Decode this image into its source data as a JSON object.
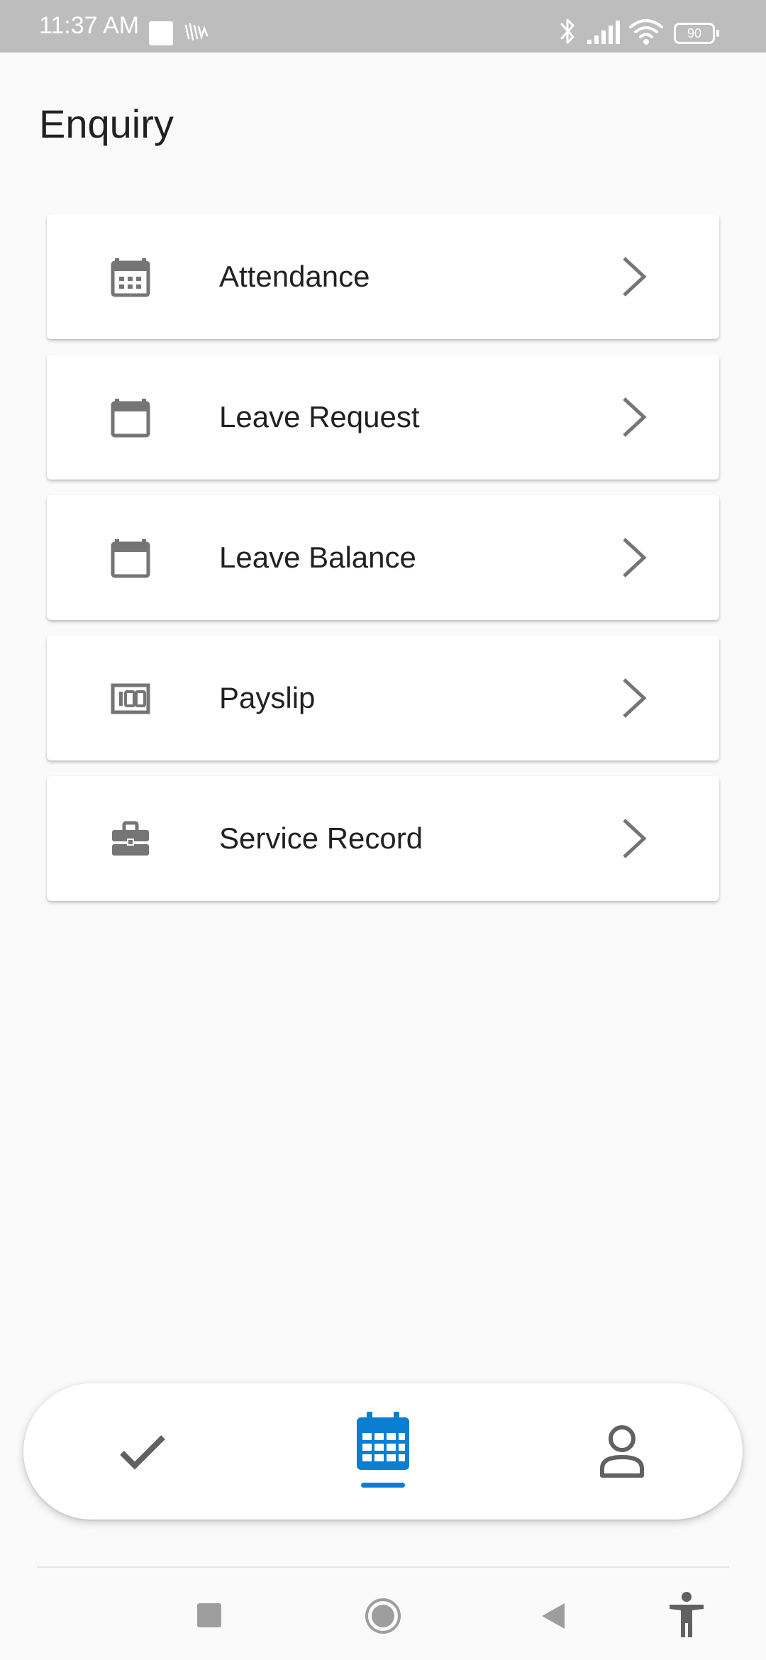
{
  "status_bar": {
    "time": "11:37 AM",
    "battery": "90",
    "icons": [
      "notification-square-icon",
      "vibrate-icon",
      "bluetooth-icon",
      "signal-icon",
      "wifi-icon",
      "battery-icon"
    ]
  },
  "page": {
    "title": "Enquiry"
  },
  "menu": {
    "items": [
      {
        "label": "Attendance",
        "icon": "calendar-grid-icon"
      },
      {
        "label": "Leave Request",
        "icon": "calendar-icon"
      },
      {
        "label": "Leave Balance",
        "icon": "calendar-icon"
      },
      {
        "label": "Payslip",
        "icon": "payslip-100-icon"
      },
      {
        "label": "Service Record",
        "icon": "briefcase-icon"
      }
    ],
    "chevron_icon": "chevron-right-icon"
  },
  "bottom_nav": {
    "items": [
      {
        "icon": "check-icon",
        "active": false
      },
      {
        "icon": "calendar-icon",
        "active": true
      },
      {
        "icon": "person-icon",
        "active": false
      }
    ],
    "active_color": "#0a7fd1",
    "inactive_color": "#616161"
  },
  "system_nav": {
    "icons": [
      "recents-square-icon",
      "home-circle-icon",
      "back-triangle-icon",
      "accessibility-icon"
    ]
  },
  "colors": {
    "background": "#fafafa",
    "status_bar": "#bdbdbd",
    "icon_gray": "#757575",
    "accent": "#0a7fd1"
  }
}
